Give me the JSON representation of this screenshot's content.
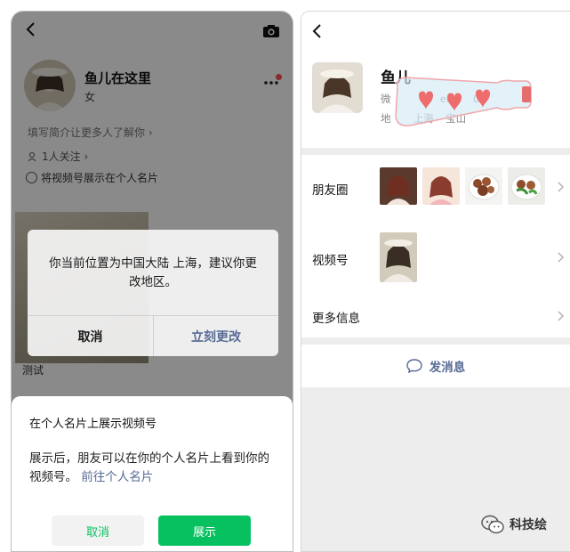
{
  "left_screen": {
    "profile": {
      "name": "鱼儿在这里",
      "gender": "女",
      "intro_prompt": "填写简介让更多人了解你 ›",
      "follow_count": "1人关注 ›",
      "channel_option": "将视频号展示在个人名片"
    },
    "video_caption": "测试",
    "location_dialog": {
      "message": "你当前位置为中国大陆 上海，建议你更改地区。",
      "cancel_label": "取消",
      "confirm_label": "立刻更改"
    },
    "bottom_sheet": {
      "title": "在个人名片上展示视频号",
      "description": "展示后，朋友可以在你的个人名片上看到你的视频号。",
      "link_text": "前往个人名片",
      "cancel_label": "取消",
      "show_label": "展示"
    }
  },
  "right_screen": {
    "profile": {
      "name": "鱼儿",
      "wechat_id_fragment": "微",
      "wechat_id_tail": "er",
      "wechat_id_end": "0",
      "region_prefix": "地",
      "region_city": "上海",
      "region_district": "宝山"
    },
    "rows": {
      "moments_label": "朋友圈",
      "channels_label": "视频号",
      "more_info_label": "更多信息"
    },
    "send_message_label": "发消息"
  },
  "watermark": {
    "text": "科技绘"
  },
  "colors": {
    "wechat_green": "#07c160",
    "link_blue": "#576b95",
    "badge_red": "#fa5151"
  }
}
